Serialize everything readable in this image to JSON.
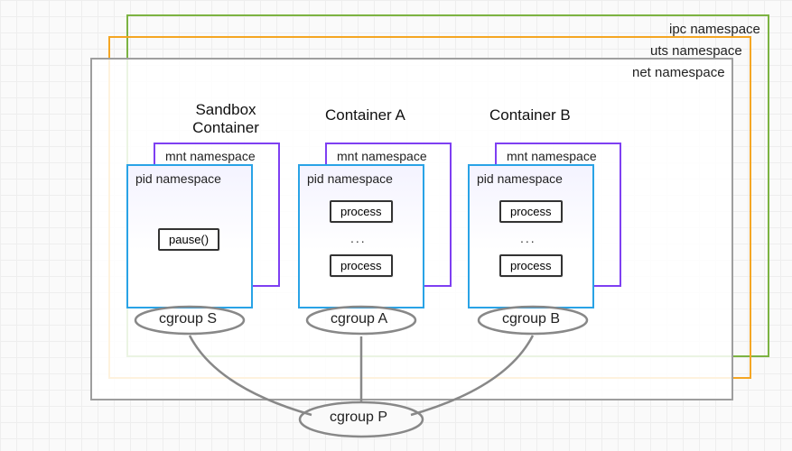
{
  "ns": {
    "ipc": "ipc namespace",
    "uts": "uts namespace",
    "net": "net namespace"
  },
  "containers": [
    {
      "title": "Sandbox\nContainer",
      "mnt_label": "mnt namespace",
      "pid_label": "pid namespace",
      "content_type": "pause",
      "pause_label": "pause()",
      "cgroup": "cgroup S"
    },
    {
      "title": "Container A",
      "mnt_label": "mnt namespace",
      "pid_label": "pid namespace",
      "content_type": "processes",
      "process_label": "process",
      "ellipsis": "...",
      "cgroup": "cgroup A"
    },
    {
      "title": "Container B",
      "mnt_label": "mnt namespace",
      "pid_label": "pid namespace",
      "content_type": "processes",
      "process_label": "process",
      "ellipsis": "...",
      "cgroup": "cgroup B"
    }
  ],
  "root_cgroup": "cgroup P",
  "colors": {
    "ipc": "#7cb342",
    "uts": "#f5a623",
    "net": "#9e9e9e",
    "mnt": "#7e3ff2",
    "pid": "#29a3e6",
    "proc": "#333333",
    "cgroup": "#888888"
  }
}
